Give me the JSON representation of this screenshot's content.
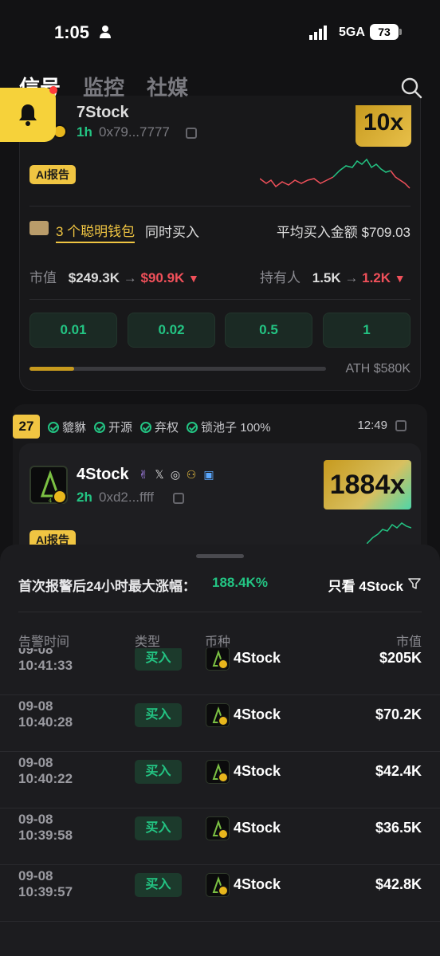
{
  "status_bar": {
    "time": "1:05",
    "network": "5GA",
    "battery": "73"
  },
  "tabs": [
    {
      "label": "信号",
      "active": true
    },
    {
      "label": "监控",
      "active": false
    },
    {
      "label": "社媒",
      "active": false
    }
  ],
  "card1": {
    "token_name": "7Stock",
    "age": "1h",
    "address": "0x79...7777",
    "multiplier": "10x",
    "ai_report": "AI报告",
    "smart_wallets": "3 个聪明钱包",
    "sync_buy": "同时买入",
    "avg_buy": "平均买入金额 $709.03",
    "market_cap_label": "市值",
    "market_cap_from": "$249.3K",
    "market_cap_to": "$90.9K",
    "holders_label": "持有人",
    "holders_from": "1.5K",
    "holders_to": "1.2K",
    "arrow": "→",
    "buy_amounts": [
      "0.01",
      "0.02",
      "0.5",
      "1"
    ],
    "ath_label": "ATH $580K",
    "ath_progress": 0.15
  },
  "card2": {
    "rank": "27",
    "tags": [
      "貔貅",
      "开源",
      "弃权",
      "锁池子 100%"
    ],
    "time": "12:49",
    "token_name": "4Stock",
    "age": "2h",
    "address": "0xd2...ffff",
    "multiplier": "1884x",
    "ai_report": "AI报告"
  },
  "sheet": {
    "title": "首次报警后24小时最大涨幅：",
    "max_gain": "188.4K%",
    "filter_label": "只看 4Stock",
    "headers": {
      "time": "告警时间",
      "type": "类型",
      "coin": "币种",
      "mcap": "市值"
    },
    "rows": [
      {
        "date": "09-08",
        "time": "10:41:33",
        "type": "买入",
        "coin": "4Stock",
        "mcap": "$205K"
      },
      {
        "date": "09-08",
        "time": "10:40:28",
        "type": "买入",
        "coin": "4Stock",
        "mcap": "$70.2K"
      },
      {
        "date": "09-08",
        "time": "10:40:22",
        "type": "买入",
        "coin": "4Stock",
        "mcap": "$42.4K"
      },
      {
        "date": "09-08",
        "time": "10:39:58",
        "type": "买入",
        "coin": "4Stock",
        "mcap": "$36.5K"
      },
      {
        "date": "09-08",
        "time": "10:39:57",
        "type": "买入",
        "coin": "4Stock",
        "mcap": "$42.8K"
      }
    ]
  },
  "colors": {
    "green": "#23c483",
    "gold": "#f0c542",
    "red": "#f0505a"
  }
}
